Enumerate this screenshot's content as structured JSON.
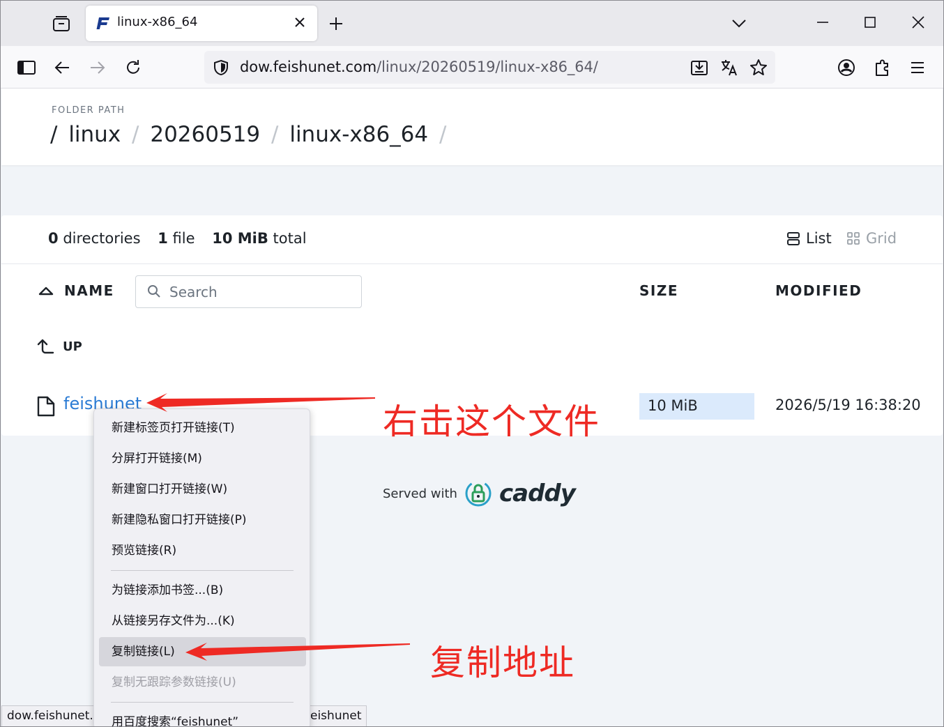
{
  "browser": {
    "tab_title": "linux-x86_64",
    "url_host": "dow.feishunet.com",
    "url_path": "/linux/20260519/linux-x86_64/"
  },
  "page": {
    "folder_label": "FOLDER PATH",
    "breadcrumb": {
      "root_sep": "/",
      "seg1": "linux",
      "seg2": "20260519",
      "seg3": "linux-x86_64",
      "sep": "/"
    },
    "summary": {
      "dir_count": "0",
      "dir_label": "directories",
      "file_count": "1",
      "file_label": "file",
      "total_size": "10 MiB",
      "total_label": "total"
    },
    "view": {
      "list_label": "List",
      "grid_label": "Grid"
    },
    "columns": {
      "name": "NAME",
      "size": "SIZE",
      "modified": "MODIFIED"
    },
    "search_placeholder": "Search",
    "up_label": "UP",
    "files": [
      {
        "name": "feishunet",
        "size": "10 MiB",
        "modified": "2026/5/19 16:38:20"
      }
    ],
    "served_with": "Served with",
    "caddy": "caddy"
  },
  "context_menu": {
    "items": [
      {
        "label": "新建标签页打开链接(T)"
      },
      {
        "label": "分屏打开链接(M)"
      },
      {
        "label": "新建窗口打开链接(W)"
      },
      {
        "label": "新建隐私窗口打开链接(P)"
      },
      {
        "label": "预览链接(R)"
      },
      {
        "label": "为链接添加书签...(B)"
      },
      {
        "label": "从链接另存文件为...(K)"
      },
      {
        "label": "复制链接(L)"
      },
      {
        "label": "复制无跟踪参数链接(U)"
      },
      {
        "label": "用百度搜索“feishunet”"
      }
    ]
  },
  "status": {
    "left": "dow.feishunet.",
    "right": "eishunet"
  },
  "annotations": {
    "right_click": "右击这个文件",
    "copy_address": "复制地址"
  },
  "colors": {
    "accent_link": "#2a7bd4",
    "size_highlight": "#dbeafc",
    "annotation_red": "#ee2a24"
  }
}
